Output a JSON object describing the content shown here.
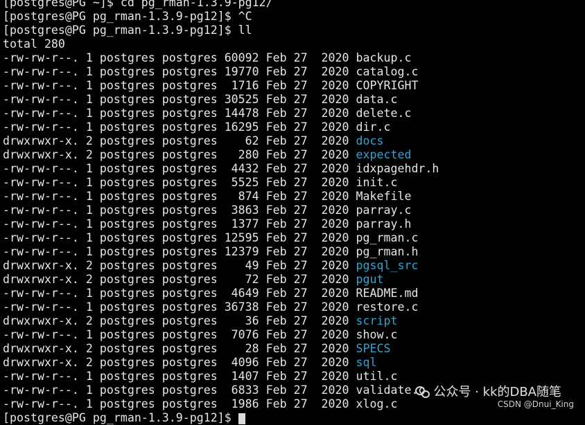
{
  "terminal": {
    "history": [
      "[postgres@PG ~]$ cd pg_rman-1.3.9-pg12/",
      "[postgres@PG pg_rman-1.3.9-pg12]$ ^C",
      "[postgres@PG pg_rman-1.3.9-pg12]$ ll",
      "total 280"
    ],
    "listing": [
      {
        "prefix": "-rw-rw-r--. 1 postgres postgres 60092 Feb 27  2020 ",
        "name": "backup.c",
        "is_dir": false
      },
      {
        "prefix": "-rw-rw-r--. 1 postgres postgres 19770 Feb 27  2020 ",
        "name": "catalog.c",
        "is_dir": false
      },
      {
        "prefix": "-rw-rw-r--. 1 postgres postgres  1716 Feb 27  2020 ",
        "name": "COPYRIGHT",
        "is_dir": false
      },
      {
        "prefix": "-rw-rw-r--. 1 postgres postgres 30525 Feb 27  2020 ",
        "name": "data.c",
        "is_dir": false
      },
      {
        "prefix": "-rw-rw-r--. 1 postgres postgres 14478 Feb 27  2020 ",
        "name": "delete.c",
        "is_dir": false
      },
      {
        "prefix": "-rw-rw-r--. 1 postgres postgres 16295 Feb 27  2020 ",
        "name": "dir.c",
        "is_dir": false
      },
      {
        "prefix": "drwxrwxr-x. 2 postgres postgres    62 Feb 27  2020 ",
        "name": "docs",
        "is_dir": true
      },
      {
        "prefix": "drwxrwxr-x. 2 postgres postgres   280 Feb 27  2020 ",
        "name": "expected",
        "is_dir": true
      },
      {
        "prefix": "-rw-rw-r--. 1 postgres postgres  4432 Feb 27  2020 ",
        "name": "idxpagehdr.h",
        "is_dir": false
      },
      {
        "prefix": "-rw-rw-r--. 1 postgres postgres  5525 Feb 27  2020 ",
        "name": "init.c",
        "is_dir": false
      },
      {
        "prefix": "-rw-rw-r--. 1 postgres postgres   874 Feb 27  2020 ",
        "name": "Makefile",
        "is_dir": false
      },
      {
        "prefix": "-rw-rw-r--. 1 postgres postgres  3863 Feb 27  2020 ",
        "name": "parray.c",
        "is_dir": false
      },
      {
        "prefix": "-rw-rw-r--. 1 postgres postgres  1377 Feb 27  2020 ",
        "name": "parray.h",
        "is_dir": false
      },
      {
        "prefix": "-rw-rw-r--. 1 postgres postgres 12595 Feb 27  2020 ",
        "name": "pg_rman.c",
        "is_dir": false
      },
      {
        "prefix": "-rw-rw-r--. 1 postgres postgres 12379 Feb 27  2020 ",
        "name": "pg_rman.h",
        "is_dir": false
      },
      {
        "prefix": "drwxrwxr-x. 2 postgres postgres    49 Feb 27  2020 ",
        "name": "pgsql_src",
        "is_dir": true
      },
      {
        "prefix": "drwxrwxr-x. 2 postgres postgres    72 Feb 27  2020 ",
        "name": "pgut",
        "is_dir": true
      },
      {
        "prefix": "-rw-rw-r--. 1 postgres postgres  4649 Feb 27  2020 ",
        "name": "README.md",
        "is_dir": false
      },
      {
        "prefix": "-rw-rw-r--. 1 postgres postgres 36738 Feb 27  2020 ",
        "name": "restore.c",
        "is_dir": false
      },
      {
        "prefix": "drwxrwxr-x. 2 postgres postgres    36 Feb 27  2020 ",
        "name": "script",
        "is_dir": true
      },
      {
        "prefix": "-rw-rw-r--. 1 postgres postgres  7076 Feb 27  2020 ",
        "name": "show.c",
        "is_dir": false
      },
      {
        "prefix": "drwxrwxr-x. 2 postgres postgres    28 Feb 27  2020 ",
        "name": "SPECS",
        "is_dir": true
      },
      {
        "prefix": "drwxrwxr-x. 2 postgres postgres  4096 Feb 27  2020 ",
        "name": "sql",
        "is_dir": true
      },
      {
        "prefix": "-rw-rw-r--. 1 postgres postgres  1407 Feb 27  2020 ",
        "name": "util.c",
        "is_dir": false
      },
      {
        "prefix": "-rw-rw-r--. 1 postgres postgres  6833 Feb 27  2020 ",
        "name": "validate.c",
        "is_dir": false
      },
      {
        "prefix": "-rw-rw-r--. 1 postgres postgres  1986 Feb 27  2020 ",
        "name": "xlog.c",
        "is_dir": false
      }
    ],
    "prompt": "[postgres@PG pg_rman-1.3.9-pg12]$ "
  },
  "watermark": {
    "main": "公众号 · kk的DBA随笔",
    "sub": "CSDN @Dnui_King",
    "icon": "wechat-icon"
  },
  "colors": {
    "background": "#000000",
    "text": "#e6e6e6",
    "directory": "#2aa7d6"
  }
}
